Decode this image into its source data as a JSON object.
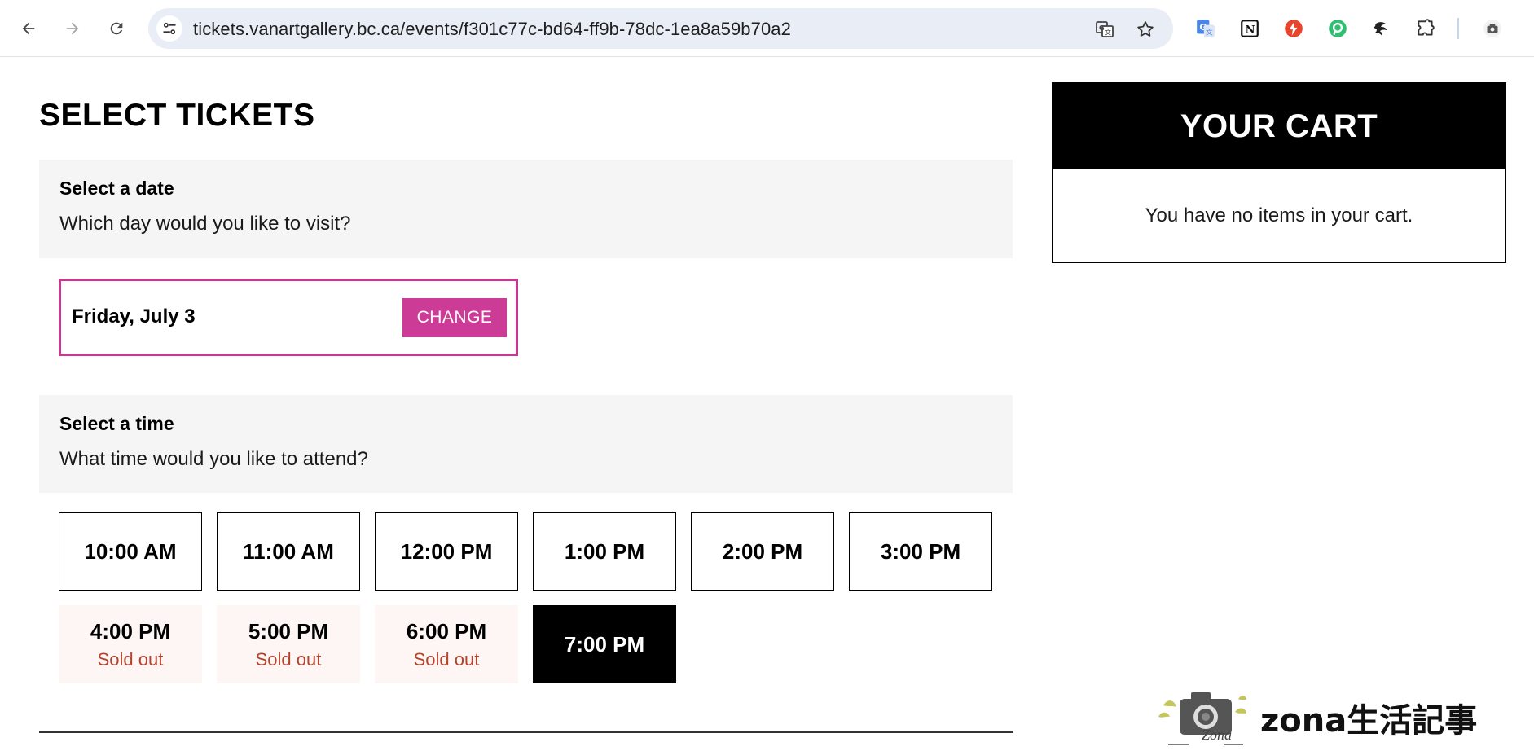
{
  "browser": {
    "url": "tickets.vanartgallery.bc.ca/events/f301c77c-bd64-ff9b-78dc-1ea8a59b70a2",
    "icons": [
      "back-icon",
      "forward-icon",
      "reload-icon",
      "site-info-icon",
      "translate-icon",
      "bookmark-star-icon",
      "google-translate-ext-icon",
      "notion-ext-icon",
      "bolt-ext-icon",
      "green-ext-icon",
      "dragon-ext-icon",
      "puzzle-extensions-icon",
      "camera-profile-icon"
    ]
  },
  "page": {
    "title": "SELECT TICKETS"
  },
  "date_section": {
    "heading": "Select a date",
    "subheading": "Which day would you like to visit?",
    "selected_date": "Friday, July 3",
    "change_label": "CHANGE",
    "accent_color": "#cc3b95"
  },
  "time_section": {
    "heading": "Select a time",
    "subheading": "What time would you like to attend?",
    "slots": [
      {
        "time": "10:00 AM",
        "status": ""
      },
      {
        "time": "11:00 AM",
        "status": ""
      },
      {
        "time": "12:00 PM",
        "status": ""
      },
      {
        "time": "1:00 PM",
        "status": ""
      },
      {
        "time": "2:00 PM",
        "status": ""
      },
      {
        "time": "3:00 PM",
        "status": ""
      },
      {
        "time": "4:00 PM",
        "status": "Sold out"
      },
      {
        "time": "5:00 PM",
        "status": "Sold out"
      },
      {
        "time": "6:00 PM",
        "status": "Sold out"
      },
      {
        "time": "7:00 PM",
        "status": "selected"
      }
    ]
  },
  "cart": {
    "title": "YOUR CART",
    "empty_message": "You have no items in your cart."
  },
  "watermark": {
    "logo_text": "Zona",
    "text": "zona生活記事"
  }
}
